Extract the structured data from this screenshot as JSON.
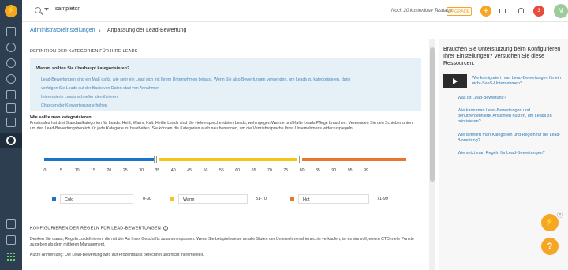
{
  "topbar": {
    "search_value": "sampleton",
    "trial_text": "Noch 20 kostenlose Testtage",
    "upgrade_label": "UPGRADE",
    "plus_label": "+",
    "notification_count": "3",
    "avatar_initial": "M"
  },
  "rail": {
    "logo_glyph": "⚡"
  },
  "breadcrumb": {
    "parent": "Administratoreinstellungen",
    "separator": "›",
    "current": "Anpassung der Lead-Bewertung"
  },
  "definition": {
    "title": "DEFINITION DER KATEGORIEN FÜR IHRE LEADS",
    "question": "Warum sollten Sie überhaupt kategorisieren?",
    "lines": [
      "Lead-Bewertungen sind ein Maß dafür, wie sehr ein Lead sich mit Ihrem Unternehmen befasst. Wenn Sie also Bewertungen verwenden, um Leads zu kategorisieren, dann",
      "verfolgen Sie Leads auf der Basis von Daten statt von Annahmen",
      "Interessierte Leads schneller identifizieren",
      "Chancen der Konvertierung erhöhen"
    ],
    "why_title": "Wie sollte man kategorisieren",
    "why_body": "Freshsales hat drei Standardkategorien für Leads: Heiß, Warm, Kalt. Heiße Leads sind die vielversprechendsten Leads, wohingegen Warme und Kalte Leads Pflege brauchen. Verwenden Sie den Schieber unten, um den Lead-Bewertungsbereich für jede Kategorie zu bearbeiten. Sie können die Kategorien auch neu benennen, um die Vertriebssprache Ihres Unternehmens widerzuspiegeln."
  },
  "slider": {
    "ticks": [
      "0",
      "5",
      "10",
      "15",
      "20",
      "25",
      "30",
      "35",
      "40",
      "45",
      "50",
      "55",
      "60",
      "65",
      "70",
      "75",
      "80",
      "85",
      "90",
      "95",
      "99"
    ],
    "colors": {
      "cold": "#1a73c8",
      "warm": "#f5c518",
      "hot": "#e8772e"
    },
    "handle_values": [
      30,
      70
    ]
  },
  "categories": [
    {
      "name": "Cold",
      "range": "0-30",
      "color": "#1a73c8"
    },
    {
      "name": "Warm",
      "range": "31-70",
      "color": "#f5c518"
    },
    {
      "name": "Hot",
      "range": "71-99",
      "color": "#e8772e"
    }
  ],
  "rules": {
    "title": "KONFIGURIEREN DER REGELN FÜR LEAD-BEWERTUNGEN",
    "help_glyph": "?",
    "body": "Denken Sie daran, Regeln zu definieren, die mit der Art Ihres Geschäfts zusammenpassen. Wenn Sie beispielsweise an alle Stufen der Unternehmenshierarchie verkaufen, ist es sinnvoll, einem CTO mehr Punkte zu geben als dem mittleren Management.",
    "note": "Kurze Anmerkung: Die Lead-Bewertung wird auf Prozentbasis berechnet und nicht inkrementell."
  },
  "right_panel": {
    "title": "Brauchen Sie Unterstützung beim Konfigurieren Ihrer Einstellungen? Versuchen Sie diese Ressourcen:",
    "video_link": "Wie konfiguriert man Lead-Bewertungen für ein nicht-SaaS-Unternehmen?",
    "links": [
      "Was ist Lead-Bewertung?",
      "Wie kann man Lead-Bewertungen und benutzerdefinierte Ansichten nutzen, um Leads zu priorisieren?",
      "Wie definiert man Kategorien und Regeln für die Lead-Bewertung?",
      "Wie setzt man Regeln für Lead-Bewertungen?"
    ]
  },
  "fabs": {
    "assistant_glyph": "⚡",
    "close_glyph": "×",
    "help_glyph": "?"
  }
}
